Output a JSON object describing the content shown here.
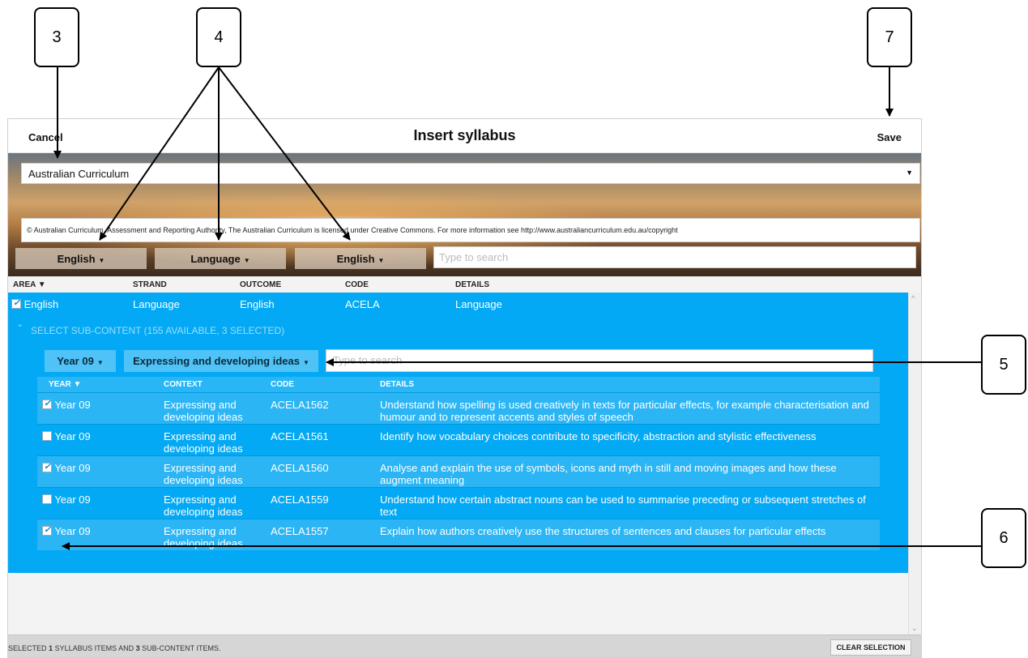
{
  "callouts": [
    "3",
    "4",
    "7",
    "5",
    "6"
  ],
  "dialog": {
    "cancel_label": "Cancel",
    "title": "Insert syllabus",
    "save_label": "Save",
    "curriculum_select": "Australian Curriculum",
    "copyright": "© Australian Curriculum, Assessment and Reporting Authority, The Australian Curriculum is licensed under Creative Commons. For more information see http://www.australiancurriculum.edu.au/copyright",
    "filters": [
      "English",
      "Language",
      "English"
    ],
    "search_placeholder": "Type to search",
    "columns": [
      "AREA ▼",
      "STRAND",
      "OUTCOME",
      "CODE",
      "DETAILS"
    ],
    "selected_row": {
      "checked": true,
      "area": "English",
      "strand": "Language",
      "outcome": "English",
      "code": "ACELA",
      "details": "Language"
    },
    "sub_content_header": "SELECT SUB-CONTENT (155 AVAILABLE, 3 SELECTED)",
    "sub_filters": [
      "Year 09",
      "Expressing and developing ideas"
    ],
    "sub_search_placeholder": "Type to search",
    "sub_columns": [
      "YEAR ▼",
      "CONTEXT",
      "CODE",
      "DETAILS"
    ],
    "sub_rows": [
      {
        "checked": true,
        "year": "Year 09",
        "context": "Expressing and developing ideas",
        "code": "ACELA1562",
        "details": "Understand how spelling is used creatively in texts for particular effects, for example characterisation and humour and to represent accents and styles of speech"
      },
      {
        "checked": false,
        "year": "Year 09",
        "context": "Expressing and developing ideas",
        "code": "ACELA1561",
        "details": "Identify how vocabulary choices contribute to specificity, abstraction and stylistic effectiveness"
      },
      {
        "checked": true,
        "year": "Year 09",
        "context": "Expressing and developing ideas",
        "code": "ACELA1560",
        "details": "Analyse and explain the use of symbols, icons and myth in still and moving images and how these augment meaning"
      },
      {
        "checked": false,
        "year": "Year 09",
        "context": "Expressing and developing ideas",
        "code": "ACELA1559",
        "details": "Understand how certain abstract nouns can be used to summarise preceding or subsequent stretches of text"
      },
      {
        "checked": true,
        "year": "Year 09",
        "context": "Expressing and developing ideas",
        "code": "ACELA1557",
        "details": "Explain how authors creatively use the structures of sentences and clauses for particular effects"
      }
    ],
    "footer": {
      "prefix": "SELECTED",
      "syllabus_count": "1",
      "middle": "SYLLABUS ITEMS AND",
      "sub_count": "3",
      "suffix": "SUB-CONTENT ITEMS."
    },
    "clear_label": "CLEAR SELECTION"
  }
}
